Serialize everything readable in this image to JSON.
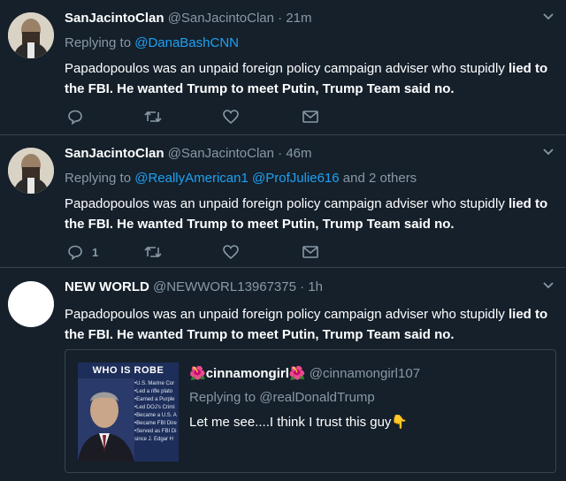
{
  "tweets": [
    {
      "name": "SanJacintoClan",
      "handle": "@SanJacintoClan",
      "dot": "·",
      "time": "21m",
      "replying_prefix": "Replying to ",
      "replying_to": "@DanaBashCNN",
      "text_a": "Papadopoulos was an unpaid foreign policy campaign adviser who stupidly ",
      "text_b": "lied to the FBI. He wanted Trump to meet Putin, Trump Team said no."
    },
    {
      "name": "SanJacintoClan",
      "handle": "@SanJacintoClan",
      "dot": "·",
      "time": "46m",
      "replying_prefix": "Replying to ",
      "replying_to_1": "@ReallyAmerican1",
      "replying_to_2": "@ProfJulie616",
      "replying_more": " and 2 others",
      "text_a": "Papadopoulos was an unpaid foreign policy campaign adviser who stupidly ",
      "text_b": "lied to the FBI. He wanted Trump to meet Putin, Trump Team said no.",
      "reply_count": "1"
    },
    {
      "name": "NEW WORLD",
      "handle": "@NEWWORL13967375",
      "dot": "·",
      "time": "1h",
      "text_a": "Papadopoulos was an unpaid foreign policy campaign adviser who stupidly ",
      "text_b": "lied to the FBI. He wanted Trump to meet Putin, Trump Team said no.",
      "quote": {
        "image_title": "WHO IS ROBE",
        "image_lines": [
          "•U.S. Marine Cor",
          "•Led a rifle plato",
          "•Earned a Purple",
          "•Led DOJ's Crimi",
          "•Became a U.S. A",
          "•Became FBI Dire",
          "•Served as FBI Di",
          "  since J. Edgar H"
        ],
        "flower": "🌺",
        "name": "cinnamongirl",
        "handle": "@cinnamongirl107",
        "replying_prefix": "Replying to ",
        "replying_to": "@realDonaldTrump",
        "text": "Let me see....I think I trust this guy👇"
      }
    }
  ],
  "icons": [
    "reply-icon",
    "retweet-icon",
    "like-icon",
    "dm-icon",
    "chevron-down-icon"
  ],
  "colors": {
    "background": "#15202b",
    "muted": "#8899a6",
    "link": "#1da1f2",
    "border": "#38444d"
  }
}
